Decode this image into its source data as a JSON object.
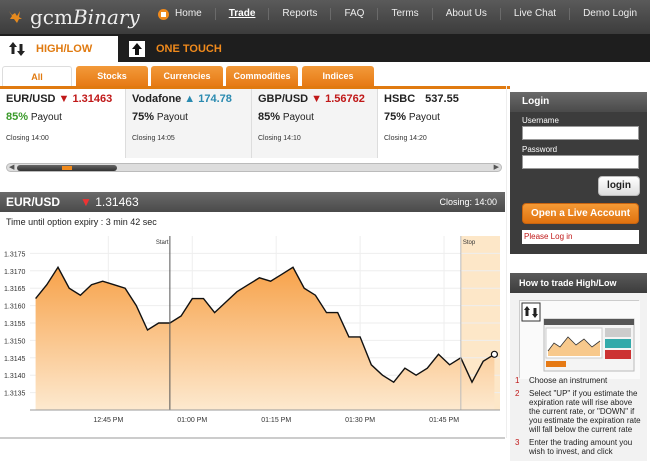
{
  "header": {
    "logo_text_1": "gcm",
    "logo_text_2": "Binary",
    "nav": [
      {
        "label": "Home",
        "active": false
      },
      {
        "label": "Trade",
        "active": true
      },
      {
        "label": "Reports",
        "active": false
      },
      {
        "label": "FAQ",
        "active": false
      },
      {
        "label": "Terms",
        "active": false
      },
      {
        "label": "About Us",
        "active": false
      },
      {
        "label": "Live Chat",
        "active": false
      },
      {
        "label": "Demo Login",
        "active": false
      }
    ]
  },
  "modes": {
    "high_low": "HIGH/LOW",
    "one_touch": "ONE TOUCH"
  },
  "categories": [
    "All",
    "Stocks",
    "Currencies",
    "Commodities",
    "Indices"
  ],
  "instruments": [
    {
      "name": "EUR/USD",
      "direction": "down",
      "price": "1.31463",
      "payout_pct": "85%",
      "payout_label": "Payout",
      "closing": "Closing 14:00"
    },
    {
      "name": "Vodafone",
      "direction": "up",
      "price": "174.78",
      "payout_pct": "75%",
      "payout_label": "Payout",
      "closing": "Closing 14:05"
    },
    {
      "name": "GBP/USD",
      "direction": "down",
      "price": "1.56762",
      "payout_pct": "85%",
      "payout_label": "Payout",
      "closing": "Closing 14:10"
    },
    {
      "name": "HSBC",
      "direction": "none",
      "price": "537.55",
      "payout_pct": "75%",
      "payout_label": "Payout",
      "closing": "Closing 14:20"
    }
  ],
  "chart_header": {
    "pair": "EUR/USD",
    "arrow": "▼",
    "value": "1.31463",
    "closing": "Closing: 14:00"
  },
  "expiry_text": "Time until option expiry : 3 min 42 sec",
  "chart_data": {
    "type": "area",
    "ylim": [
      1.313,
      1.318
    ],
    "yticks": [
      "1.3175",
      "1.3170",
      "1.3165",
      "1.3160",
      "1.3155",
      "1.3150",
      "1.3145",
      "1.3140",
      "1.3135"
    ],
    "xticks": [
      "12:45 PM",
      "01:00 PM",
      "01:15 PM",
      "01:30 PM",
      "01:45 PM"
    ],
    "start_label": "Start",
    "stop_label": "Stop",
    "start_x": "12:56",
    "stop_x": "01:48",
    "x": [
      "12:32",
      "12:34",
      "12:36",
      "12:38",
      "12:40",
      "12:42",
      "12:44",
      "12:46",
      "12:48",
      "12:50",
      "12:52",
      "12:54",
      "12:56",
      "12:58",
      "13:00",
      "13:02",
      "13:04",
      "13:06",
      "13:08",
      "13:10",
      "13:12",
      "13:14",
      "13:16",
      "13:18",
      "13:20",
      "13:22",
      "13:24",
      "13:26",
      "13:28",
      "13:30",
      "13:32",
      "13:34",
      "13:36",
      "13:38",
      "13:40",
      "13:42",
      "13:44",
      "13:46",
      "13:48",
      "13:50",
      "13:52",
      "13:54"
    ],
    "values": [
      1.3162,
      1.3166,
      1.3171,
      1.3165,
      1.3163,
      1.3166,
      1.3167,
      1.3166,
      1.3165,
      1.316,
      1.3153,
      1.3155,
      1.3155,
      1.3157,
      1.3162,
      1.3162,
      1.3158,
      1.3161,
      1.3164,
      1.3166,
      1.3168,
      1.3167,
      1.3169,
      1.3171,
      1.3165,
      1.3163,
      1.3158,
      1.3158,
      1.3151,
      1.3151,
      1.3143,
      1.314,
      1.3138,
      1.3142,
      1.314,
      1.3142,
      1.3146,
      1.3143,
      1.3145,
      1.3138,
      1.3144,
      1.3146
    ]
  },
  "login": {
    "title": "Login",
    "username_label": "Username",
    "password_label": "Password",
    "login_button": "login",
    "live_account_button": "Open a Live Account",
    "error": "Please Log in"
  },
  "howto": {
    "title": "How to trade High/Low",
    "steps": [
      {
        "n": "1",
        "text": "Choose an instrument"
      },
      {
        "n": "2",
        "text": "Select \"UP\" if you estimate the expiration rate will rise above the current rate, or \"DOWN\" if you estimate the expiration rate will fall below the current rate"
      },
      {
        "n": "3",
        "text": "Enter the trading amount you wish to invest, and click"
      }
    ]
  },
  "colors": {
    "accent": "#e67a15",
    "up": "#2a8ab0",
    "down": "#c01818",
    "payout_green": "#3a9a2a"
  }
}
